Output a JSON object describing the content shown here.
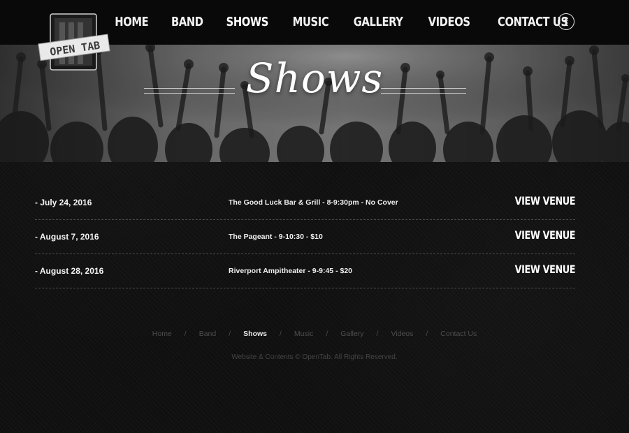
{
  "brand": {
    "logo_text": "OPEN TAB"
  },
  "nav": {
    "items": [
      {
        "label": "HOME"
      },
      {
        "label": "BAND"
      },
      {
        "label": "SHOWS"
      },
      {
        "label": "MUSIC"
      },
      {
        "label": "GALLERY"
      },
      {
        "label": "VIDEOS"
      },
      {
        "label": "CONTACT US"
      }
    ],
    "facebook_icon": "f"
  },
  "hero": {
    "title": "Shows"
  },
  "shows": [
    {
      "date": "- July 24, 2016",
      "details": "The Good Luck Bar & Grill - 8-9:30pm - No Cover",
      "link": "VIEW VENUE"
    },
    {
      "date": "- August 7, 2016",
      "details": "The Pageant - 9-10:30 - $10",
      "link": "VIEW VENUE"
    },
    {
      "date": "- August 28, 2016",
      "details": "Riverport Ampitheater - 9-9:45 - $20",
      "link": "VIEW VENUE"
    }
  ],
  "footer": {
    "links": [
      "Home",
      "Band",
      "Shows",
      "Music",
      "Gallery",
      "Videos",
      "Contact Us"
    ],
    "separator": "/",
    "copyright": "Website & Contents © OpenTab. All Rights Reserved."
  }
}
